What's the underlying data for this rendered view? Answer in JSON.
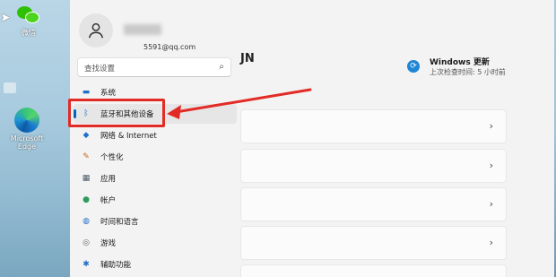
{
  "desktop": {
    "icons": [
      {
        "name": "wechat",
        "label": "微信"
      },
      {
        "name": "edge",
        "label": "Microsoft\nEdge"
      }
    ]
  },
  "settings": {
    "profile": {
      "email": "5591@qq.com"
    },
    "search": {
      "placeholder": "查找设置"
    },
    "nav": [
      {
        "label": "系统",
        "icon": "monitor-icon"
      },
      {
        "label": "蓝牙和其他设备",
        "icon": "bluetooth-icon"
      },
      {
        "label": "网络 & Internet",
        "icon": "wifi-icon"
      },
      {
        "label": "个性化",
        "icon": "brush-icon"
      },
      {
        "label": "应用",
        "icon": "apps-icon"
      },
      {
        "label": "帐户",
        "icon": "account-icon"
      },
      {
        "label": "时间和语言",
        "icon": "globe-clock-icon"
      },
      {
        "label": "游戏",
        "icon": "gamepad-icon"
      },
      {
        "label": "辅助功能",
        "icon": "accessibility-icon"
      }
    ],
    "main": {
      "title": "JN",
      "windows_update": {
        "title": "Windows 更新",
        "subtitle": "上次检查时间: 5 小时前"
      }
    }
  },
  "annotation": {
    "color": "#e32b26"
  }
}
